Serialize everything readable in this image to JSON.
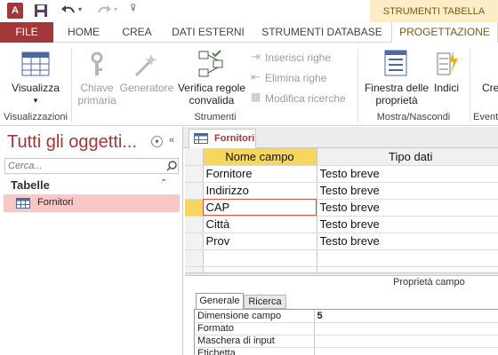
{
  "qat": {
    "app_icon": "access-app-icon",
    "save_icon": "save-icon",
    "undo_icon": "undo-icon",
    "redo_icon": "redo-icon",
    "customize_icon": "customize-qat-icon"
  },
  "context_header": "STRUMENTI TABELLA",
  "tabs": [
    {
      "label": "FILE"
    },
    {
      "label": "HOME"
    },
    {
      "label": "CREA"
    },
    {
      "label": "DATI ESTERNI"
    },
    {
      "label": "STRUMENTI DATABASE"
    },
    {
      "label": "PROGETTAZIONE"
    }
  ],
  "ribbon": {
    "visualizza": "Visualizza",
    "chiave_1": "Chiave",
    "chiave_2": "primaria",
    "generatore": "Generatore",
    "verifica_1": "Verifica regole",
    "verifica_2": "convalida",
    "inserisci": "Inserisci righe",
    "elimina": "Elimina righe",
    "modifica": "Modifica ricerche",
    "finestra_1": "Finestra delle",
    "finestra_2": "proprietà",
    "indici": "Indici",
    "cre_1": "Cre",
    "cre_2": "",
    "groups": {
      "visualizzazioni": "Visualizzazioni",
      "strumenti": "Strumenti",
      "mostra": "Mostra/Nascondi",
      "eventi": "Event"
    }
  },
  "nav": {
    "title": "Tutti gli oggetti...",
    "search_placeholder": "Cerca...",
    "section": "Tabelle",
    "items": [
      {
        "label": "Fornitori"
      }
    ]
  },
  "document": {
    "tab_label": "Fornitori",
    "columns": [
      "Nome campo",
      "Tipo dati"
    ],
    "rows": [
      {
        "name": "Fornitore",
        "type": "Testo breve"
      },
      {
        "name": "Indirizzo",
        "type": "Testo breve"
      },
      {
        "name": "CAP",
        "type": "Testo breve"
      },
      {
        "name": "Città",
        "type": "Testo breve"
      },
      {
        "name": "Prov",
        "type": "Testo breve"
      }
    ],
    "selected_row": 2
  },
  "properties": {
    "title": "Proprietà campo",
    "tabs": [
      "Generale",
      "Ricerca"
    ],
    "rows": [
      {
        "label": "Dimensione campo",
        "value": "5"
      },
      {
        "label": "Formato",
        "value": ""
      },
      {
        "label": "Maschera di input",
        "value": ""
      },
      {
        "label": "Etichetta",
        "value": ""
      }
    ]
  },
  "colors": {
    "access_red": "#a4373a",
    "context_yellow": "#fbeec6",
    "selected_cell_border": "#d9534f",
    "header_yellow": "#f6d65f",
    "nav_selected": "#f8c8c8"
  }
}
